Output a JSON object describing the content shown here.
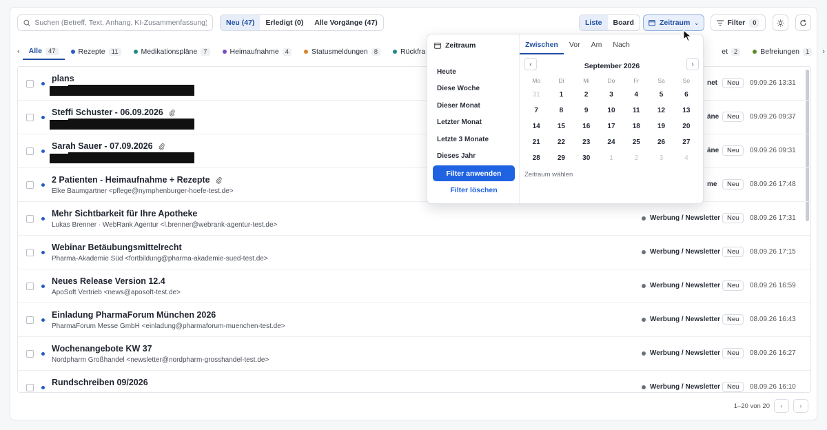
{
  "search": {
    "placeholder": "Suchen (Betreff, Text, Anhang, KI-Zusammenfassung) ..."
  },
  "status_tabs": [
    {
      "label": "Neu (47)",
      "active": true
    },
    {
      "label": "Erledigt (0)",
      "active": false
    },
    {
      "label": "Alle Vorgänge (47)",
      "active": false
    }
  ],
  "view_tabs": [
    {
      "label": "Liste",
      "active": true
    },
    {
      "label": "Board",
      "active": false
    }
  ],
  "toolbar": {
    "zeitraum_label": "Zeitraum",
    "filter_label": "Filter",
    "filter_count": "0"
  },
  "categories": [
    {
      "label": "Alle",
      "count": "47",
      "color": "",
      "active": true
    },
    {
      "label": "Rezepte",
      "count": "11",
      "color": "#2859c5"
    },
    {
      "label": "Medikationspläne",
      "count": "7",
      "color": "#1f8a86"
    },
    {
      "label": "Heimaufnahme",
      "count": "4",
      "color": "#7b4cc0"
    },
    {
      "label": "Statusmeldungen",
      "count": "8",
      "color": "#d9822b"
    },
    {
      "label": "Rückfra",
      "count": "",
      "color": "#1f8a86"
    },
    {
      "label": "et",
      "count": "2",
      "color": ""
    },
    {
      "label": "Befreiungen",
      "count": "1",
      "color": "#5a8a2a"
    }
  ],
  "rows": [
    {
      "subject": "plans",
      "from": "",
      "redacted": true,
      "attach": false,
      "tag": "",
      "tagfrag": "net",
      "status": "Neu",
      "date": "09.09.26 13:31"
    },
    {
      "subject": "Steffi Schuster - 06.09.2026",
      "from": "",
      "redacted": true,
      "attach": true,
      "tag": "",
      "tagfrag": "äne",
      "status": "Neu",
      "date": "09.09.26 09:37"
    },
    {
      "subject": "Sarah Sauer - 07.09.2026",
      "from": "",
      "redacted": true,
      "attach": true,
      "tag": "",
      "tagfrag": "äne",
      "status": "Neu",
      "date": "09.09.26 09:31"
    },
    {
      "subject": "2 Patienten - Heimaufnahme + Rezepte",
      "from": "Elke Baumgartner <pflege@nymphenburger-hoefe-test.de>",
      "redacted": false,
      "attach": true,
      "tag": "",
      "tagfrag": "me",
      "status": "Neu",
      "date": "08.09.26 17:48"
    },
    {
      "subject": "Mehr Sichtbarkeit für Ihre Apotheke",
      "from": "Lukas Brenner · WebRank Agentur <l.brenner@webrank-agentur-test.de>",
      "redacted": false,
      "attach": false,
      "tag": "Werbung / Newsletter",
      "tagfrag": "",
      "status": "Neu",
      "date": "08.09.26 17:31"
    },
    {
      "subject": "Webinar Betäubungsmittelrecht",
      "from": "Pharma-Akademie Süd <fortbildung@pharma-akademie-sued-test.de>",
      "redacted": false,
      "attach": false,
      "tag": "Werbung / Newsletter",
      "tagfrag": "",
      "status": "Neu",
      "date": "08.09.26 17:15"
    },
    {
      "subject": "Neues Release Version 12.4",
      "from": "ApoSoft Vertrieb <news@aposoft-test.de>",
      "redacted": false,
      "attach": false,
      "tag": "Werbung / Newsletter",
      "tagfrag": "",
      "status": "Neu",
      "date": "08.09.26 16:59"
    },
    {
      "subject": "Einladung PharmaForum München 2026",
      "from": "PharmaForum Messe GmbH <einladung@pharmaforum-muenchen-test.de>",
      "redacted": false,
      "attach": false,
      "tag": "Werbung / Newsletter",
      "tagfrag": "",
      "status": "Neu",
      "date": "08.09.26 16:43"
    },
    {
      "subject": "Wochenangebote KW 37",
      "from": "Nordpharm Großhandel <newsletter@nordpharm-grosshandel-test.de>",
      "redacted": false,
      "attach": false,
      "tag": "Werbung / Newsletter",
      "tagfrag": "",
      "status": "Neu",
      "date": "08.09.26 16:27"
    },
    {
      "subject": "Rundschreiben 09/2026",
      "from": "",
      "redacted": false,
      "attach": false,
      "tag": "Werbung / Newsletter",
      "tagfrag": "",
      "status": "Neu",
      "date": "08.09.26 16:10"
    }
  ],
  "pagination": {
    "label": "1–20 von 20"
  },
  "popover": {
    "title": "Zeitraum",
    "presets": [
      "Heute",
      "Diese Woche",
      "Dieser Monat",
      "Letzter Monat",
      "Letzte 3 Monate",
      "Dieses Jahr"
    ],
    "apply_label": "Filter anwenden",
    "clear_label": "Filter löschen",
    "mode_tabs": [
      {
        "label": "Zwischen",
        "active": true
      },
      {
        "label": "Vor",
        "active": false
      },
      {
        "label": "Am",
        "active": false
      },
      {
        "label": "Nach",
        "active": false
      }
    ],
    "month_label": "September 2026",
    "weekdays": [
      "Mo",
      "Di",
      "Mi",
      "Do",
      "Fr",
      "Sa",
      "So"
    ],
    "days": [
      {
        "d": "31",
        "m": true
      },
      {
        "d": "1"
      },
      {
        "d": "2"
      },
      {
        "d": "3"
      },
      {
        "d": "4"
      },
      {
        "d": "5"
      },
      {
        "d": "6"
      },
      {
        "d": "7"
      },
      {
        "d": "8"
      },
      {
        "d": "9"
      },
      {
        "d": "10"
      },
      {
        "d": "11"
      },
      {
        "d": "12"
      },
      {
        "d": "13"
      },
      {
        "d": "14"
      },
      {
        "d": "15"
      },
      {
        "d": "16"
      },
      {
        "d": "17"
      },
      {
        "d": "18"
      },
      {
        "d": "19"
      },
      {
        "d": "20"
      },
      {
        "d": "21"
      },
      {
        "d": "22"
      },
      {
        "d": "23"
      },
      {
        "d": "24"
      },
      {
        "d": "25"
      },
      {
        "d": "26"
      },
      {
        "d": "27"
      },
      {
        "d": "28"
      },
      {
        "d": "29"
      },
      {
        "d": "30"
      },
      {
        "d": "1",
        "m": true
      },
      {
        "d": "2",
        "m": true
      },
      {
        "d": "3",
        "m": true
      },
      {
        "d": "4",
        "m": true
      }
    ],
    "hint": "Zeitraum wählen"
  }
}
